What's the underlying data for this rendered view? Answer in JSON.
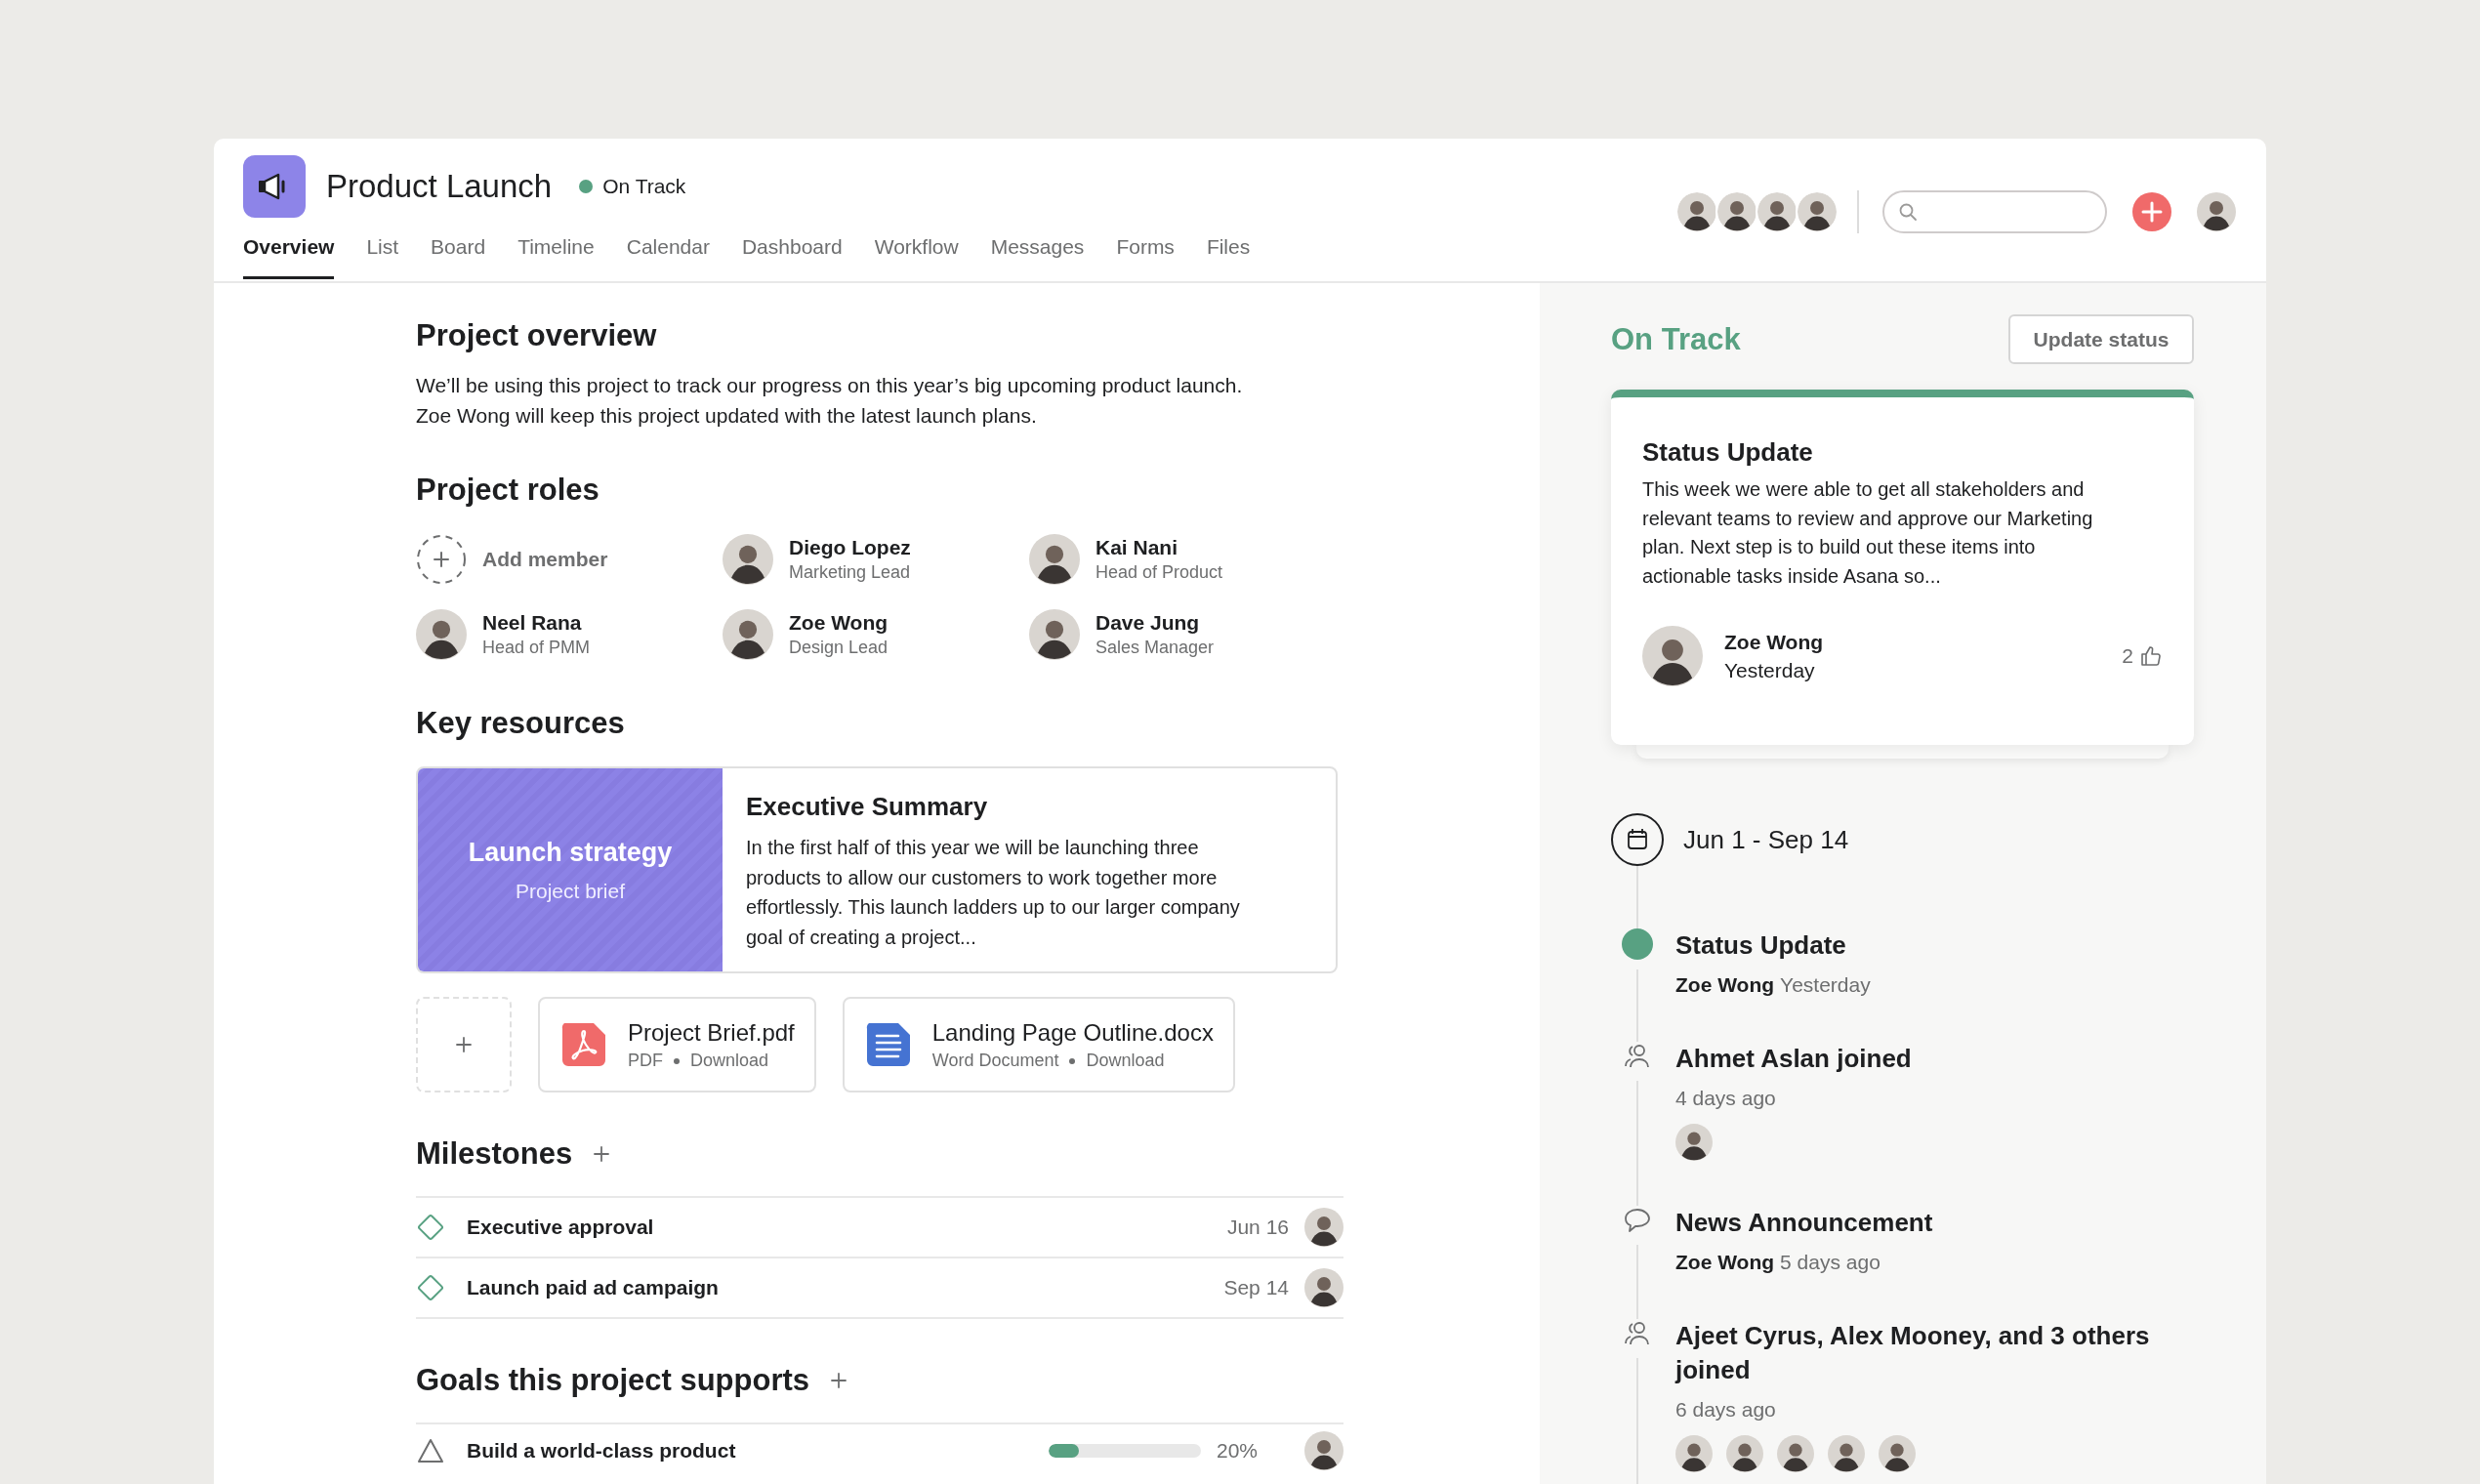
{
  "project": {
    "title": "Product Launch",
    "status": {
      "label": "On Track",
      "color": "#58a182"
    }
  },
  "tabs": [
    {
      "label": "Overview",
      "selected": true
    },
    {
      "label": "List",
      "selected": false
    },
    {
      "label": "Board",
      "selected": false
    },
    {
      "label": "Timeline",
      "selected": false
    },
    {
      "label": "Calendar",
      "selected": false
    },
    {
      "label": "Dashboard",
      "selected": false
    },
    {
      "label": "Workflow",
      "selected": false
    },
    {
      "label": "Messages",
      "selected": false
    },
    {
      "label": "Forms",
      "selected": false
    },
    {
      "label": "Files",
      "selected": false
    }
  ],
  "header_members": [
    {
      "kind": "person"
    },
    {
      "kind": "person"
    },
    {
      "kind": "person"
    },
    {
      "kind": "person"
    }
  ],
  "overview": {
    "heading": "Project overview",
    "text": "We’ll be using this project to track our progress on this year’s big upcoming product launch.\nZoe Wong will keep this project updated with the latest launch plans."
  },
  "roles": {
    "heading": "Project roles",
    "add_label": "Add member",
    "members": [
      {
        "name": "Diego Lopez",
        "role": "Marketing Lead"
      },
      {
        "name": "Kai Nani",
        "role": "Head of Product"
      },
      {
        "name": "Neel Rana",
        "role": "Head of PMM"
      },
      {
        "name": "Zoe Wong",
        "role": "Design Lead"
      },
      {
        "name": "Dave Jung",
        "role": "Sales Manager"
      }
    ]
  },
  "resources": {
    "heading": "Key resources",
    "featured": {
      "title": "Launch strategy",
      "subtitle": "Project brief",
      "summary_title": "Executive Summary",
      "summary": "In the first half of this year we will be launching three\nproducts to allow our customers to work together more\neffortlessly. This launch ladders up to our larger company\ngoal of creating a project..."
    },
    "files": [
      {
        "kind": "pdf",
        "name": "Project Brief.pdf",
        "type": "PDF",
        "action": "Download"
      },
      {
        "kind": "doc",
        "name": "Landing Page Outline.docx",
        "type": "Word Document",
        "action": "Download"
      }
    ]
  },
  "milestones": {
    "heading": "Milestones",
    "rows": [
      {
        "title": "Executive approval",
        "date": "Jun 16"
      },
      {
        "title": "Launch paid ad campaign",
        "date": "Sep 14"
      }
    ]
  },
  "goals": {
    "heading": "Goals this project supports",
    "rows": [
      {
        "title": "Build a world-class product",
        "level": 0.2,
        "reading": "20%"
      }
    ]
  },
  "status_panel": {
    "status": {
      "label": "On Track",
      "color": "#58a182"
    },
    "button": "Update status",
    "card": {
      "title": "Status Update",
      "text": "This week we were able to get all stakeholders and\nrelevant teams to review and approve our Marketing\nplan. Next step is to build out these items into\nactionable tasks inside Asana so...",
      "author": "Zoe Wong",
      "time": "Yesterday",
      "likes": "2"
    },
    "date_range": "Jun 1 - Sep 14",
    "timeline": [
      {
        "kind": "status",
        "title": "Status Update",
        "author": "Zoe Wong",
        "time": "Yesterday"
      },
      {
        "kind": "joined",
        "title": "Ahmet Aslan joined",
        "time": "4 days ago",
        "avatars": [
          {
            "kind": "person"
          }
        ]
      },
      {
        "kind": "comment",
        "title": "News Announcement",
        "author": "Zoe Wong",
        "time": "5 days ago"
      },
      {
        "kind": "joined",
        "title": "Ajeet Cyrus, Alex Mooney, and 3 others joined",
        "time": "6 days ago",
        "avatars": [
          {
            "kind": "person"
          },
          {
            "kind": "person"
          },
          {
            "kind": "person"
          },
          {
            "kind": "person"
          },
          {
            "kind": "person"
          }
        ]
      }
    ]
  }
}
